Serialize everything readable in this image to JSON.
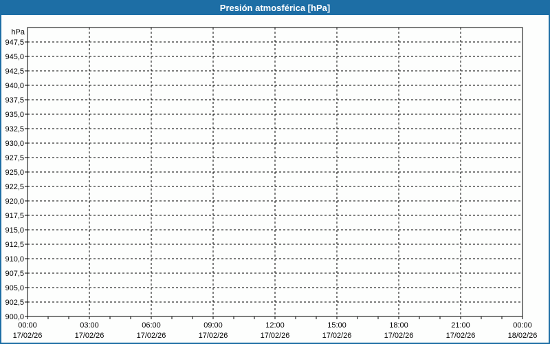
{
  "window": {
    "title": "Presión atmosférica [hPa]"
  },
  "colors": {
    "accent": "#1d6ea5",
    "background": "#fdfefd",
    "grid": "#000000",
    "axis_text": "#000000",
    "title_text": "#ffffff"
  },
  "chart_data": {
    "type": "line",
    "title": "Presión atmosférica [hPa]",
    "ylabel": "hPa",
    "xlabel": "",
    "ylim": [
      900,
      950
    ],
    "y_tick_step": 2.5,
    "y_tick_labels": [
      "947,5",
      "945,0",
      "942,5",
      "940,0",
      "937,5",
      "935,0",
      "932,5",
      "930,0",
      "927,5",
      "925,0",
      "922,5",
      "920,0",
      "917,5",
      "915,0",
      "912,5",
      "910,0",
      "907,5",
      "905,0",
      "902,5",
      "900,0"
    ],
    "x_range_hours": 24,
    "x_major_tick_hours": 3,
    "x_minor_tick_hours": 1,
    "x_major_ticks": [
      {
        "time": "00:00",
        "date": "17/02/26"
      },
      {
        "time": "03:00",
        "date": "17/02/26"
      },
      {
        "time": "06:00",
        "date": "17/02/26"
      },
      {
        "time": "09:00",
        "date": "17/02/26"
      },
      {
        "time": "12:00",
        "date": "17/02/26"
      },
      {
        "time": "15:00",
        "date": "17/02/26"
      },
      {
        "time": "18:00",
        "date": "17/02/26"
      },
      {
        "time": "21:00",
        "date": "17/02/26"
      },
      {
        "time": "00:00",
        "date": "18/02/26"
      }
    ],
    "grid": "dashed",
    "legend": "none",
    "series": []
  }
}
